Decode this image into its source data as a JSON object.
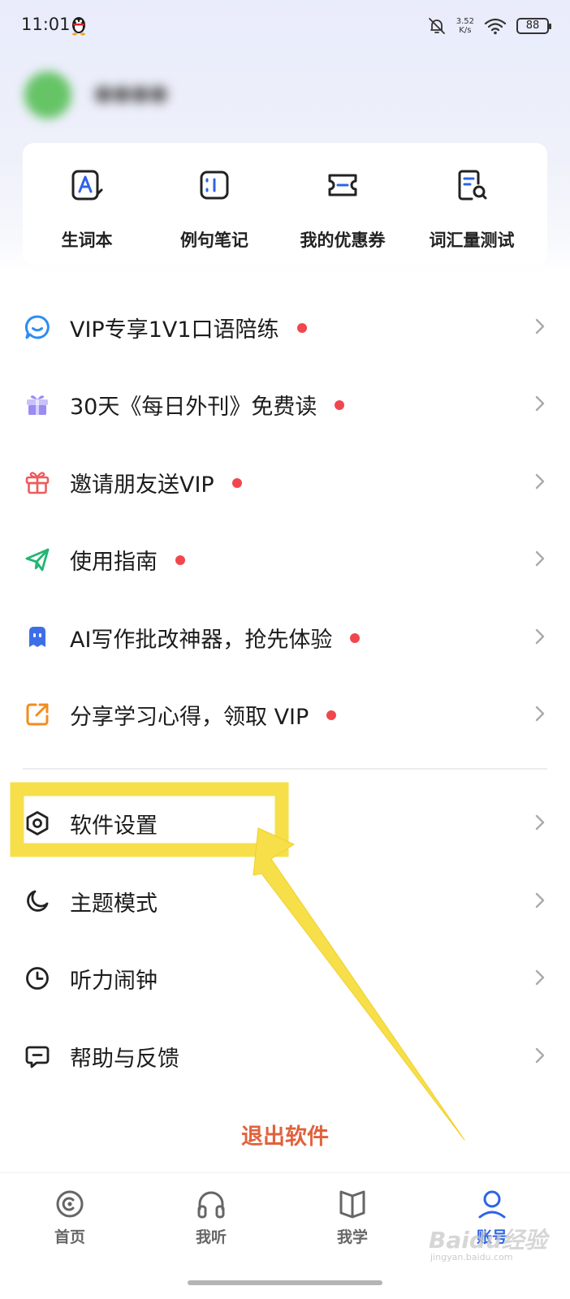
{
  "status_bar": {
    "time": "11:01",
    "net_speed_value": "3.52",
    "net_speed_unit": "K/s",
    "battery": "88"
  },
  "profile": {
    "username": "●●●●"
  },
  "quick_tools": [
    {
      "label": "生词本",
      "icon": "vocabulary-book-icon"
    },
    {
      "label": "例句笔记",
      "icon": "sentence-notes-icon"
    },
    {
      "label": "我的优惠券",
      "icon": "coupon-icon"
    },
    {
      "label": "词汇量测试",
      "icon": "vocab-test-icon"
    }
  ],
  "menu": {
    "promos": [
      {
        "label": "VIP专享1V1口语陪练",
        "icon": "chat-bubble-icon",
        "icon_color": "#2d8cf0",
        "badge": true
      },
      {
        "label": "30天《每日外刊》免费读",
        "icon": "gift-box-icon",
        "icon_color": "#9a8cf2",
        "badge": true
      },
      {
        "label": "邀请朋友送VIP",
        "icon": "gift-icon",
        "icon_color": "#ef5b5b",
        "badge": true
      },
      {
        "label": "使用指南",
        "icon": "paper-plane-icon",
        "icon_color": "#22b573",
        "badge": true
      },
      {
        "label": "AI写作批改神器，抢先体验",
        "icon": "robot-icon",
        "icon_color": "#3d6ee8",
        "badge": true
      },
      {
        "label": "分享学习心得，领取 VIP",
        "icon": "share-icon",
        "icon_color": "#f28c1e",
        "badge": true
      }
    ],
    "settings": [
      {
        "label": "软件设置",
        "icon": "settings-hexagon-icon"
      },
      {
        "label": "主题模式",
        "icon": "moon-icon"
      },
      {
        "label": "听力闹钟",
        "icon": "clock-icon"
      },
      {
        "label": "帮助与反馈",
        "icon": "feedback-icon"
      }
    ]
  },
  "logout_label": "退出软件",
  "bottom_nav": [
    {
      "label": "首页",
      "icon": "home-icon",
      "active": false
    },
    {
      "label": "我听",
      "icon": "headphones-icon",
      "active": false
    },
    {
      "label": "我学",
      "icon": "book-icon",
      "active": false
    },
    {
      "label": "账号",
      "icon": "account-icon",
      "active": true
    }
  ],
  "colors": {
    "accent": "#2d63e8",
    "badge_red": "#f0474f",
    "logout": "#e0623c",
    "annotation_yellow": "#f7df4a"
  },
  "watermark": {
    "text": "Baidu经验",
    "sub": "jingyan.baidu.com"
  }
}
